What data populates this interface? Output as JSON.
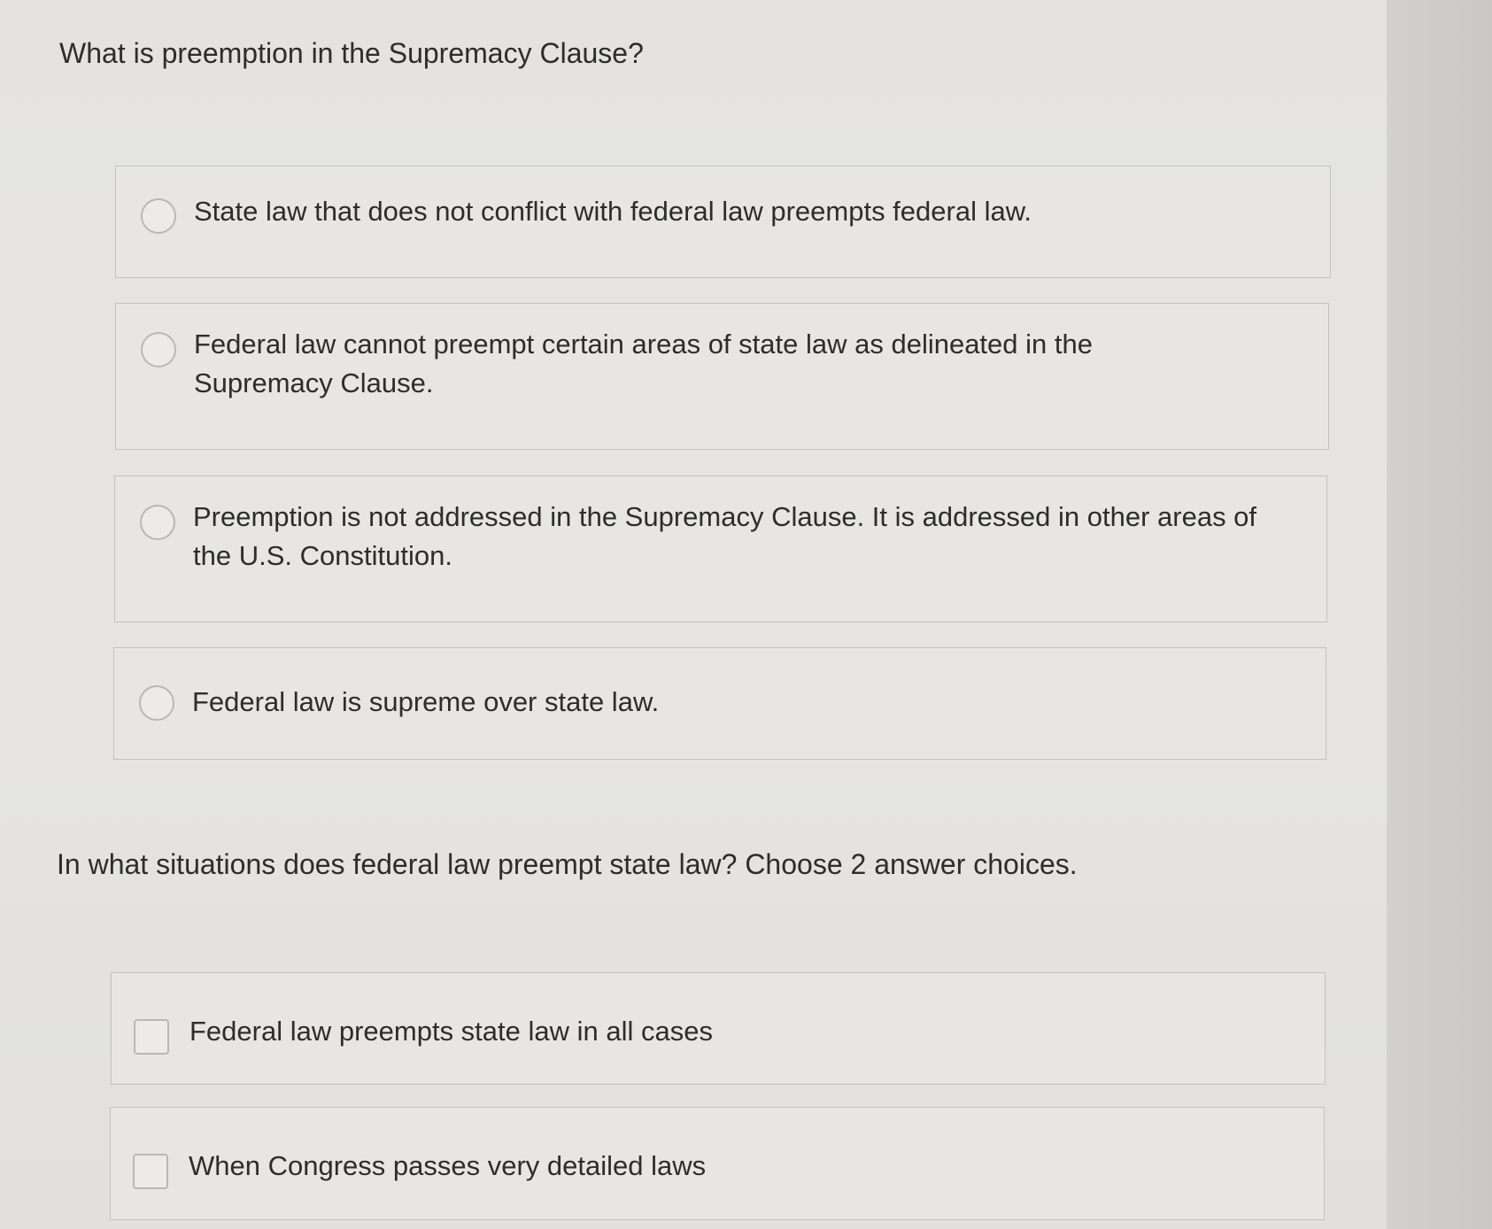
{
  "questions": [
    {
      "title": "What is preemption in the Supremacy Clause?",
      "type": "radio",
      "options": [
        "State law that does not conflict with federal law preempts federal law.",
        "Federal law cannot preempt certain areas of state law as delineated in the Supremacy Clause.",
        "Preemption is not addressed in the Supremacy Clause. It is addressed in other areas of the U.S. Constitution.",
        "Federal law is supreme over state law."
      ]
    },
    {
      "title": "In what situations does federal law preempt state law? Choose 2 answer choices.",
      "type": "checkbox",
      "options": [
        "Federal law preempts state law in all cases",
        "When Congress passes very detailed laws"
      ]
    }
  ]
}
